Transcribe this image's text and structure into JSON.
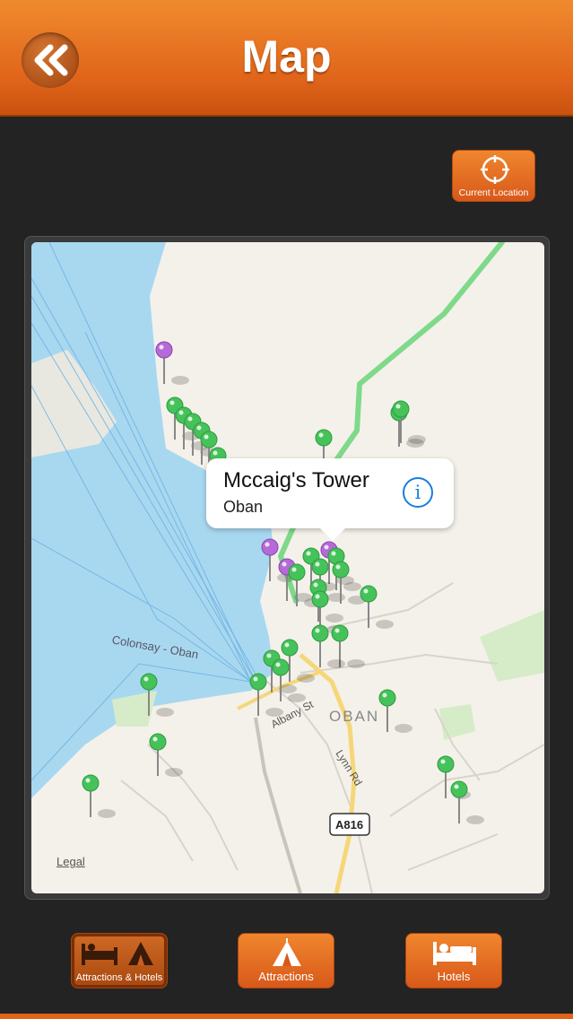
{
  "header": {
    "title": "Map"
  },
  "current_location": {
    "label": "Current Location"
  },
  "map": {
    "callout": {
      "title": "Mccaig's Tower",
      "subtitle": "Oban"
    },
    "labels": {
      "town": "OBAN",
      "ferry": "Colonsay - Oban",
      "street1": "Albany St",
      "street2": "Lynn Rd",
      "road": "A816"
    },
    "legal": "Legal"
  },
  "tabs": [
    {
      "label": "Attractions & Hotels"
    },
    {
      "label": "Attractions"
    },
    {
      "label": "Hotels"
    }
  ],
  "colors": {
    "accent": "#e0641a",
    "water": "#a8d8f0",
    "land": "#f4f1ea",
    "pin_green": "#45c35a",
    "pin_purple": "#b66ad8",
    "route": "#7fd98a"
  }
}
